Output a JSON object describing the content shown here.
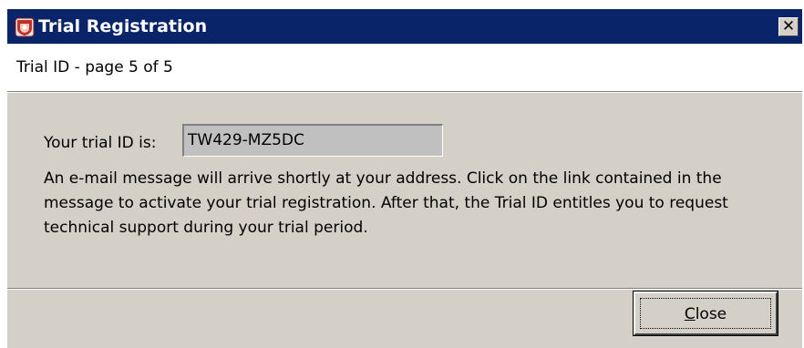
{
  "window": {
    "title": "Trial Registration",
    "close_glyph": "✕",
    "icon": "app-shield-icon",
    "title_bar_color": "#0a246a",
    "face_color": "#d4d0c8"
  },
  "header": {
    "page_text": "Trial ID - page 5 of 5"
  },
  "content": {
    "trial_id_label": "Your trial ID is:",
    "trial_id_value": "TW429-MZ5DC",
    "message": "An e-mail message will arrive shortly at your address. Click on the link contained in the message to activate your trial registration. After that, the Trial ID entitles you to request technical support during your trial period."
  },
  "footer": {
    "close_mnemonic": "C",
    "close_rest": "lose"
  }
}
